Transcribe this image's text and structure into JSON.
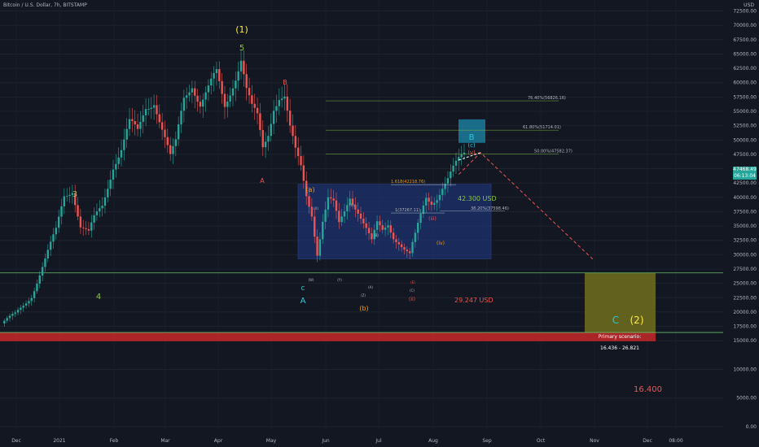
{
  "header": {
    "title": "Bitcoin / U.S. Dollar, 7h, BITSTAMP",
    "currency": "USD"
  },
  "price_tag": {
    "price": "47468.49",
    "countdown": "06:13:04"
  },
  "colors": {
    "background": "#131722",
    "candle_up": "#26a69a",
    "candle_down": "#ef5350",
    "wave_green": "#8bc34a",
    "wave_yellow": "#ffeb3b",
    "wave_orange": "#ff9800",
    "wave_teal": "#26c6da",
    "correction_box": "#1e3a8a",
    "target_box": "#6b6a1e",
    "support_band": "#c62828"
  },
  "chart_data": {
    "type": "candlestick",
    "x_ticks": [
      "Dec",
      "2021",
      "Feb",
      "Mar",
      "Apr",
      "May",
      "Jun",
      "Jul",
      "Aug",
      "Sep",
      "Oct",
      "Nov",
      "Dec",
      "08:00"
    ],
    "y_ticks": [
      "0.00",
      "5000.00",
      "10000.00",
      "15000.00",
      "17500.00",
      "20000.00",
      "22500.00",
      "25000.00",
      "27500.00",
      "30000.00",
      "32500.00",
      "35000.00",
      "37500.00",
      "40000.00",
      "42500.00",
      "45000.00",
      "47500.00",
      "50000.00",
      "52500.00",
      "55000.00",
      "57500.00",
      "60000.00",
      "62500.00",
      "65000.00",
      "67500.00",
      "70000.00",
      "72500.00"
    ],
    "ylim": [
      0,
      73000
    ],
    "price_path": [
      [
        0,
        18000
      ],
      [
        5,
        19500
      ],
      [
        11,
        23000
      ],
      [
        16,
        29000
      ],
      [
        20,
        34000
      ],
      [
        23,
        40500
      ],
      [
        26,
        41800
      ],
      [
        29,
        35000
      ],
      [
        32,
        33500
      ],
      [
        34,
        36000
      ],
      [
        37,
        38500
      ],
      [
        41,
        46000
      ],
      [
        44,
        48500
      ],
      [
        47,
        52500
      ],
      [
        50,
        51000
      ],
      [
        53,
        56000
      ],
      [
        56,
        57500
      ],
      [
        59,
        52000
      ],
      [
        62,
        46500
      ],
      [
        64,
        49000
      ],
      [
        67,
        57500
      ],
      [
        70,
        60500
      ],
      [
        73,
        56500
      ],
      [
        76,
        58500
      ],
      [
        79,
        61000
      ],
      [
        82,
        56000
      ],
      [
        85,
        60500
      ],
      [
        88,
        64500
      ],
      [
        90,
        58500
      ],
      [
        92,
        55000
      ],
      [
        94,
        53500
      ],
      [
        96,
        48500
      ],
      [
        98,
        51500
      ],
      [
        100,
        56500
      ],
      [
        102,
        58000
      ],
      [
        104,
        57500
      ],
      [
        106,
        51500
      ],
      [
        108,
        47500
      ],
      [
        110,
        45000
      ],
      [
        112,
        40500
      ],
      [
        114,
        37500
      ],
      [
        116,
        30500
      ],
      [
        118,
        36000
      ],
      [
        120,
        39500
      ],
      [
        122,
        38500
      ],
      [
        124,
        35000
      ],
      [
        126,
        37500
      ],
      [
        128,
        40500
      ],
      [
        131,
        38000
      ],
      [
        134,
        34500
      ],
      [
        136,
        32000
      ],
      [
        138,
        35000
      ],
      [
        140,
        34000
      ],
      [
        142,
        35500
      ],
      [
        144,
        33500
      ],
      [
        146,
        32500
      ],
      [
        148,
        31000
      ],
      [
        150,
        29800
      ],
      [
        151,
        31500
      ],
      [
        152,
        33000
      ],
      [
        154,
        36500
      ],
      [
        156,
        40000
      ],
      [
        158,
        39500
      ],
      [
        160,
        40500
      ],
      [
        162,
        42000
      ],
      [
        164,
        43000
      ],
      [
        166,
        44500
      ],
      [
        168,
        46000
      ],
      [
        170,
        47468
      ]
    ],
    "horizontal_lines": [
      {
        "price": 26821,
        "color": "#66bb6a"
      },
      {
        "price": 16436,
        "color": "#66bb6a"
      }
    ],
    "fib_levels": [
      {
        "label": "76.40%(56826.16)",
        "price": 56826.16
      },
      {
        "label": "61.80%(51714.01)",
        "price": 51714.01
      },
      {
        "label": "50.00%(47582.37)",
        "price": 47582.37
      },
      {
        "label": "1.618(42218.76)",
        "price": 42218.76
      },
      {
        "label": "1(37267.11)",
        "price": 37267.11
      },
      {
        "label": "38.20%(37598.46)",
        "price": 37598.46
      }
    ],
    "wave_labels": [
      {
        "text": "(1)",
        "color": "#ffeb3b"
      },
      {
        "text": "5",
        "color": "#8bc34a"
      },
      {
        "text": "3",
        "color": "#8bc34a"
      },
      {
        "text": "4",
        "color": "#8bc34a"
      },
      {
        "text": "B",
        "color": "#ef5350"
      },
      {
        "text": "A",
        "color": "#ef5350"
      },
      {
        "text": "(a)",
        "color": "#ff9800"
      },
      {
        "text": "(b)",
        "color": "#ff9800"
      },
      {
        "text": "C",
        "color": "#26c6da"
      },
      {
        "text": "A",
        "color": "#26c6da"
      },
      {
        "text": "B",
        "color": "#26c6da"
      },
      {
        "text": "(c)",
        "color": "#26c6da"
      },
      {
        "text": "(v)",
        "color": "#ef5350"
      },
      {
        "text": "(iii)",
        "color": "#ef5350"
      },
      {
        "text": "(iv)",
        "color": "#ff9800"
      },
      {
        "text": "(ii)",
        "color": "#ef5350"
      },
      {
        "text": "(W)",
        "color": "#b2b5be"
      },
      {
        "text": "(X)",
        "color": "#b2b5be"
      },
      {
        "text": "(Y)",
        "color": "#b2b5be"
      },
      {
        "text": "(X)",
        "color": "#b2b5be"
      },
      {
        "text": "(B)",
        "color": "#b2b5be"
      },
      {
        "text": "(Z)",
        "color": "#b2b5be"
      },
      {
        "text": "(A)",
        "color": "#b2b5be"
      },
      {
        "text": "(C)",
        "color": "#b2b5be"
      },
      {
        "text": "(E)",
        "color": "#ef5350"
      },
      {
        "text": "C",
        "color": "#26c6da"
      },
      {
        "text": "(2)",
        "color": "#ffeb3b"
      }
    ],
    "annotations": {
      "price_high": "42.300 USD",
      "price_low": "29.247 USD",
      "support": "16.400",
      "scenario_title": "Primary scenario:",
      "scenario_range": "16.436 - 26.821"
    }
  }
}
